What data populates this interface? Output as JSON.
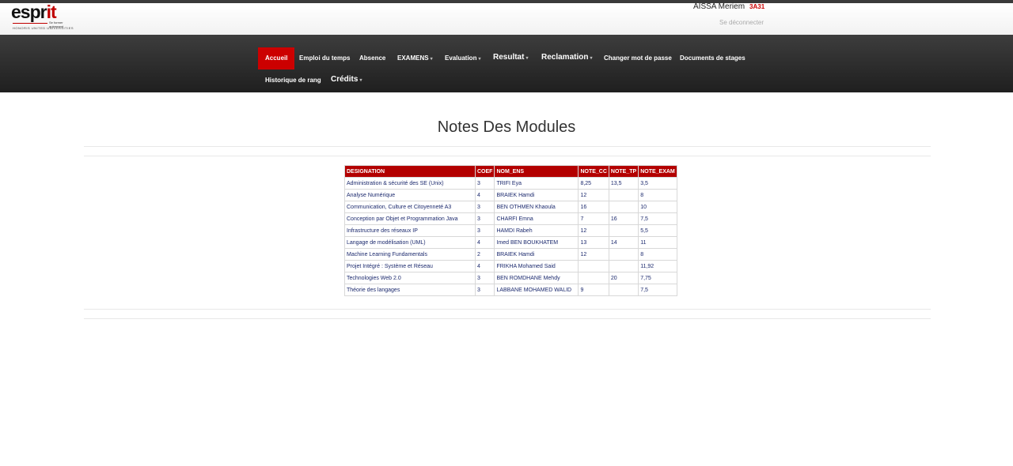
{
  "header": {
    "logo_text": "esprit",
    "logo_tagline": "Se former autrement",
    "logo_sub": "HONORIS UNITED UNIVERSITIES",
    "user_name": "AISSA Meriem",
    "user_class": "3A31",
    "logout": "Se déconnecter"
  },
  "nav": {
    "accueil": "Accueil",
    "emploi": "Emploi du temps",
    "absence": "Absence",
    "examens": "EXAMENS",
    "evaluation": "Evaluation",
    "resultat": "Resultat",
    "reclamation": "Reclamation",
    "changer": "Changer mot de passe",
    "documents": "Documents de stages",
    "historique": "Historique de rang",
    "credits": "Crédits"
  },
  "page": {
    "title": "Notes Des Modules"
  },
  "table": {
    "headers": [
      "DESIGNATION",
      "COEF",
      "NOM_ENS",
      "NOTE_CC",
      "NOTE_TP",
      "NOTE_EXAM"
    ],
    "rows": [
      [
        "Administration & sécurité des SE (Unix)",
        "3",
        "TRIFI Eya",
        "8,25",
        "13,5",
        "3,5"
      ],
      [
        "Analyse Numérique",
        "4",
        "BRAIEK Hamdi",
        "12",
        "",
        "8"
      ],
      [
        "Communication, Culture et Citoyenneté A3",
        "3",
        "BEN OTHMEN Khaoula",
        "16",
        "",
        "10"
      ],
      [
        "Conception par Objet et Programmation Java",
        "3",
        "CHARFI Emna",
        "7",
        "16",
        "7,5"
      ],
      [
        "Infrastructure des réseaux IP",
        "3",
        "HAMDI Rabeh",
        "12",
        "",
        "5,5"
      ],
      [
        "Langage de modélisation (UML)",
        "4",
        "Imed BEN BOUKHATEM",
        "13",
        "14",
        "11"
      ],
      [
        "Machine Learning Fundamentals",
        "2",
        "BRAIEK Hamdi",
        "12",
        "",
        "8"
      ],
      [
        "Projet Intégré : Système et Réseau",
        "4",
        "FRIKHA Mohamed Said",
        "",
        "",
        "11,92"
      ],
      [
        "Technologies Web 2.0",
        "3",
        "BEN ROMDHANE Mehdy",
        "",
        "20",
        "7,75"
      ],
      [
        "Théorie des langages",
        "3",
        "LABBANE MOHAMED WALID",
        "9",
        "",
        "7,5"
      ]
    ]
  },
  "colors": {
    "accent": "#cc0000",
    "nav_bg": "#2a2a2a",
    "table_header": "#b30000",
    "cell_text": "#1c2a6e"
  },
  "icons": {
    "dropdown": "caret-down-icon"
  }
}
